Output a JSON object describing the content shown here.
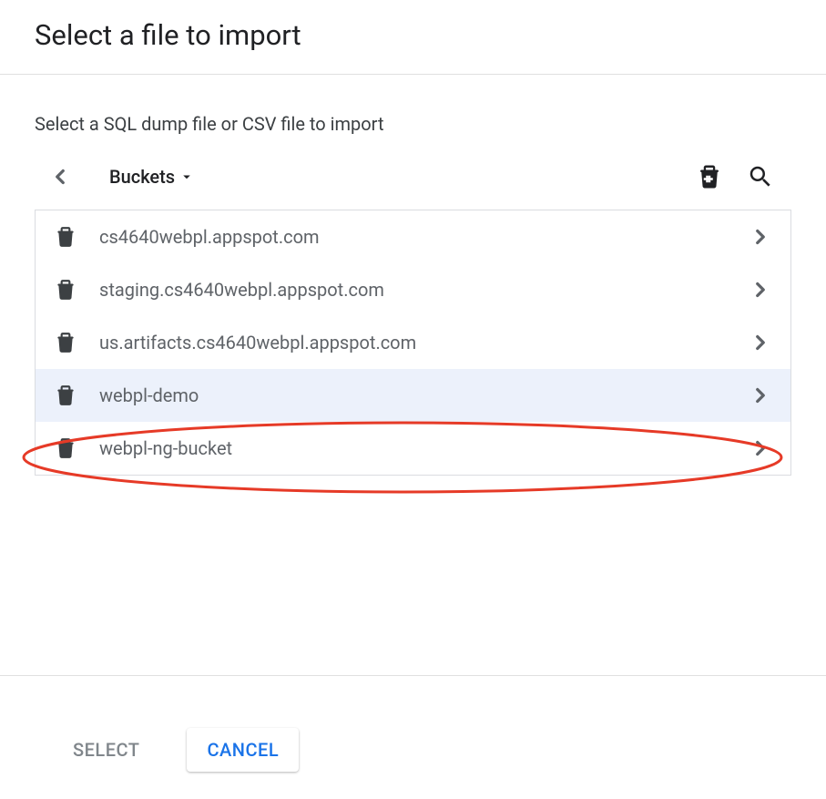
{
  "dialog": {
    "title": "Select a file to import",
    "subtitle": "Select a SQL dump file or CSV file to import"
  },
  "breadcrumb": {
    "label": "Buckets"
  },
  "buckets": [
    {
      "name": "cs4640webpl.appspot.com",
      "highlighted": false
    },
    {
      "name": "staging.cs4640webpl.appspot.com",
      "highlighted": false
    },
    {
      "name": "us.artifacts.cs4640webpl.appspot.com",
      "highlighted": false
    },
    {
      "name": "webpl-demo",
      "highlighted": true
    },
    {
      "name": "webpl-ng-bucket",
      "highlighted": false
    }
  ],
  "footer": {
    "select_label": "SELECT",
    "cancel_label": "CANCEL"
  },
  "annotation": {
    "highlighted_index": 3,
    "color": "#e63a27"
  }
}
